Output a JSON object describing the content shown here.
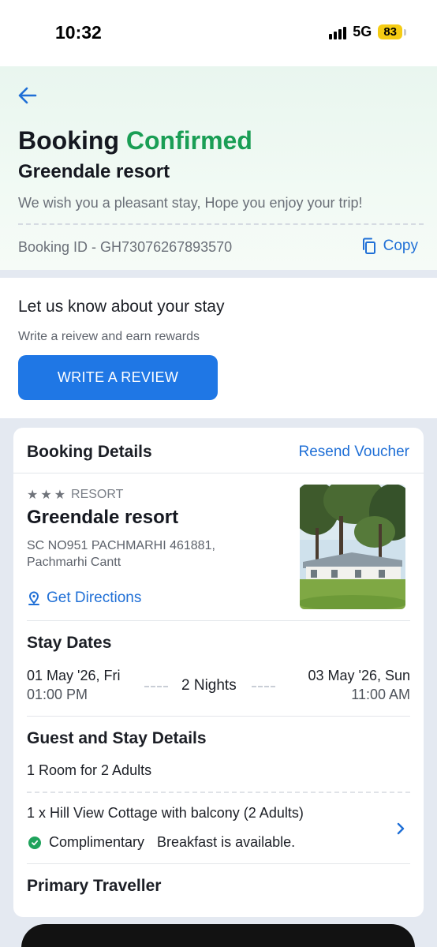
{
  "status_bar": {
    "time": "10:32",
    "network": "5G",
    "battery": "83"
  },
  "header": {
    "title_prefix": "Booking",
    "title_status": "Confirmed",
    "hotel_name": "Greendale resort",
    "message": "We wish you a pleasant stay, Hope you enjoy your trip!",
    "booking_id": "Booking ID - GH73076267893570",
    "copy_label": "Copy"
  },
  "review": {
    "heading": "Let us know about your stay",
    "subtext": "Write a reivew and earn rewards",
    "button_label": "WRITE A REVIEW"
  },
  "booking_details": {
    "title": "Booking Details",
    "resend_label": "Resend Voucher",
    "star_rating": 3,
    "property_type": "RESORT",
    "hotel_name": "Greendale resort",
    "address": "SC NO951 PACHMARHI 461881, Pachmarhi Cantt",
    "directions_label": "Get Directions",
    "stay_dates": {
      "title": "Stay Dates",
      "checkin_date": "01 May '26, Fri",
      "checkin_time": "01:00 PM",
      "nights": "2 Nights",
      "checkout_date": "03 May '26, Sun",
      "checkout_time": "11:00 AM"
    },
    "guest_details": {
      "title": "Guest and Stay Details",
      "rooms": "1 Room for 2 Adults",
      "room_type": "1 x Hill View Cottage with balcony (2 Adults)",
      "meal_tag": "Complimentary",
      "meal_note": "Breakfast is available."
    },
    "primary_traveller_title": "Primary Traveller"
  },
  "colors": {
    "accent": "#1f6fd6",
    "button": "#1f77e5",
    "confirmed": "#1a9e55",
    "check": "#1fa35c"
  }
}
